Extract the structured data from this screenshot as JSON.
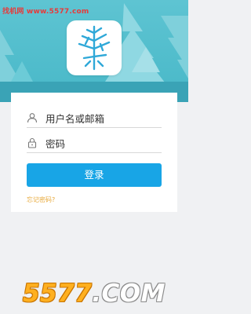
{
  "watermark": {
    "top_text": "找机网 www.5577.com",
    "bottom_number": "5577",
    "bottom_domain": ".COM"
  },
  "app": {
    "icon": "pine-tree-logo-icon"
  },
  "login_form": {
    "username_placeholder": "用户名或邮箱",
    "password_placeholder": "密码",
    "login_button_label": "登录",
    "forgot_password_link": "忘记密码?",
    "username_icon": "user-icon",
    "password_icon": "lock-icon"
  },
  "colors": {
    "header_bg": "#5ec4d2",
    "tree_light": "#8fd8e2",
    "tree_dark": "#3aa3b6",
    "icon_blue": "#2fa8d8",
    "button_bg": "#18a5e6",
    "forgot_link": "#e8a93a",
    "page_bg": "#f0f1f3"
  }
}
